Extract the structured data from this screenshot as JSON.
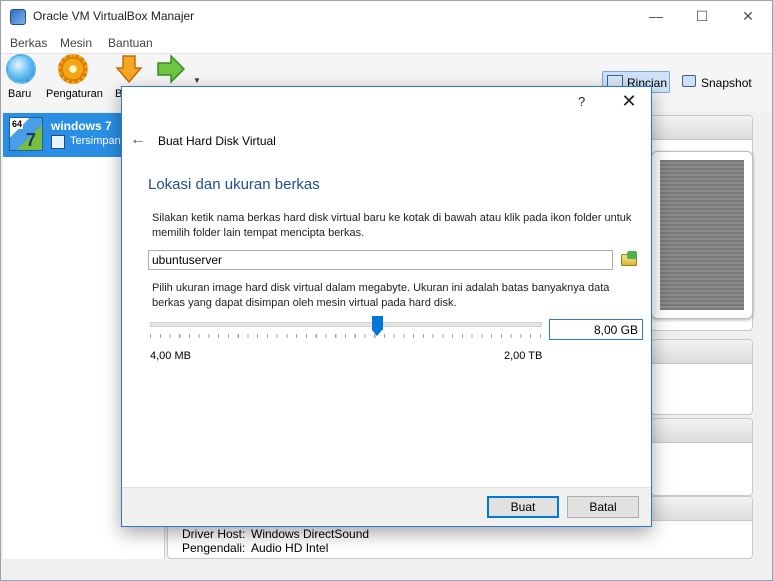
{
  "window": {
    "title": "Oracle VM VirtualBox Manajer",
    "controls": {
      "minimize": "—",
      "maximize": "☐",
      "close": "✕"
    }
  },
  "menu": {
    "items": [
      "Berkas",
      "Mesin",
      "Bantuan"
    ]
  },
  "toolbar": {
    "new_label": "Baru",
    "settings_label": "Pengaturan",
    "discard_label": "B",
    "details_label": "Rincian",
    "snapshot_label": "Snapshot"
  },
  "vm_list": {
    "items": [
      {
        "name": "windows 7",
        "state": "Tersimpan",
        "os_badge": "64",
        "os_num": "7"
      }
    ]
  },
  "details": {
    "audio": {
      "rows": [
        {
          "key": "Driver Host:",
          "value": "Windows DirectSound"
        },
        {
          "key": "Pengendali:",
          "value": "Audio HD Intel"
        }
      ]
    }
  },
  "dialog": {
    "help": "?",
    "close": "✕",
    "back_arrow": "←",
    "wizard_title": "Buat Hard Disk Virtual",
    "heading": "Lokasi dan ukuran berkas",
    "description_file": "Silakan ketik nama berkas hard disk virtual baru ke kotak di bawah atau klik pada ikon folder untuk memilih folder lain tempat mencipta berkas.",
    "file_name": "ubuntuserver",
    "description_size": "Pilih ukuran image hard disk virtual dalam megabyte. Ukuran ini adalah batas banyaknya data berkas yang dapat disimpan oleh mesin virtual pada hard disk.",
    "size_value": "8,00 GB",
    "slider_position": 0.58,
    "min_size_label": "4,00 MB",
    "max_size_label": "2,00 TB",
    "create_label": "Buat",
    "cancel_label": "Batal"
  },
  "colors": {
    "accent": "#0078d7",
    "selection": "#2a8fe4",
    "heading": "#1f4e91"
  }
}
